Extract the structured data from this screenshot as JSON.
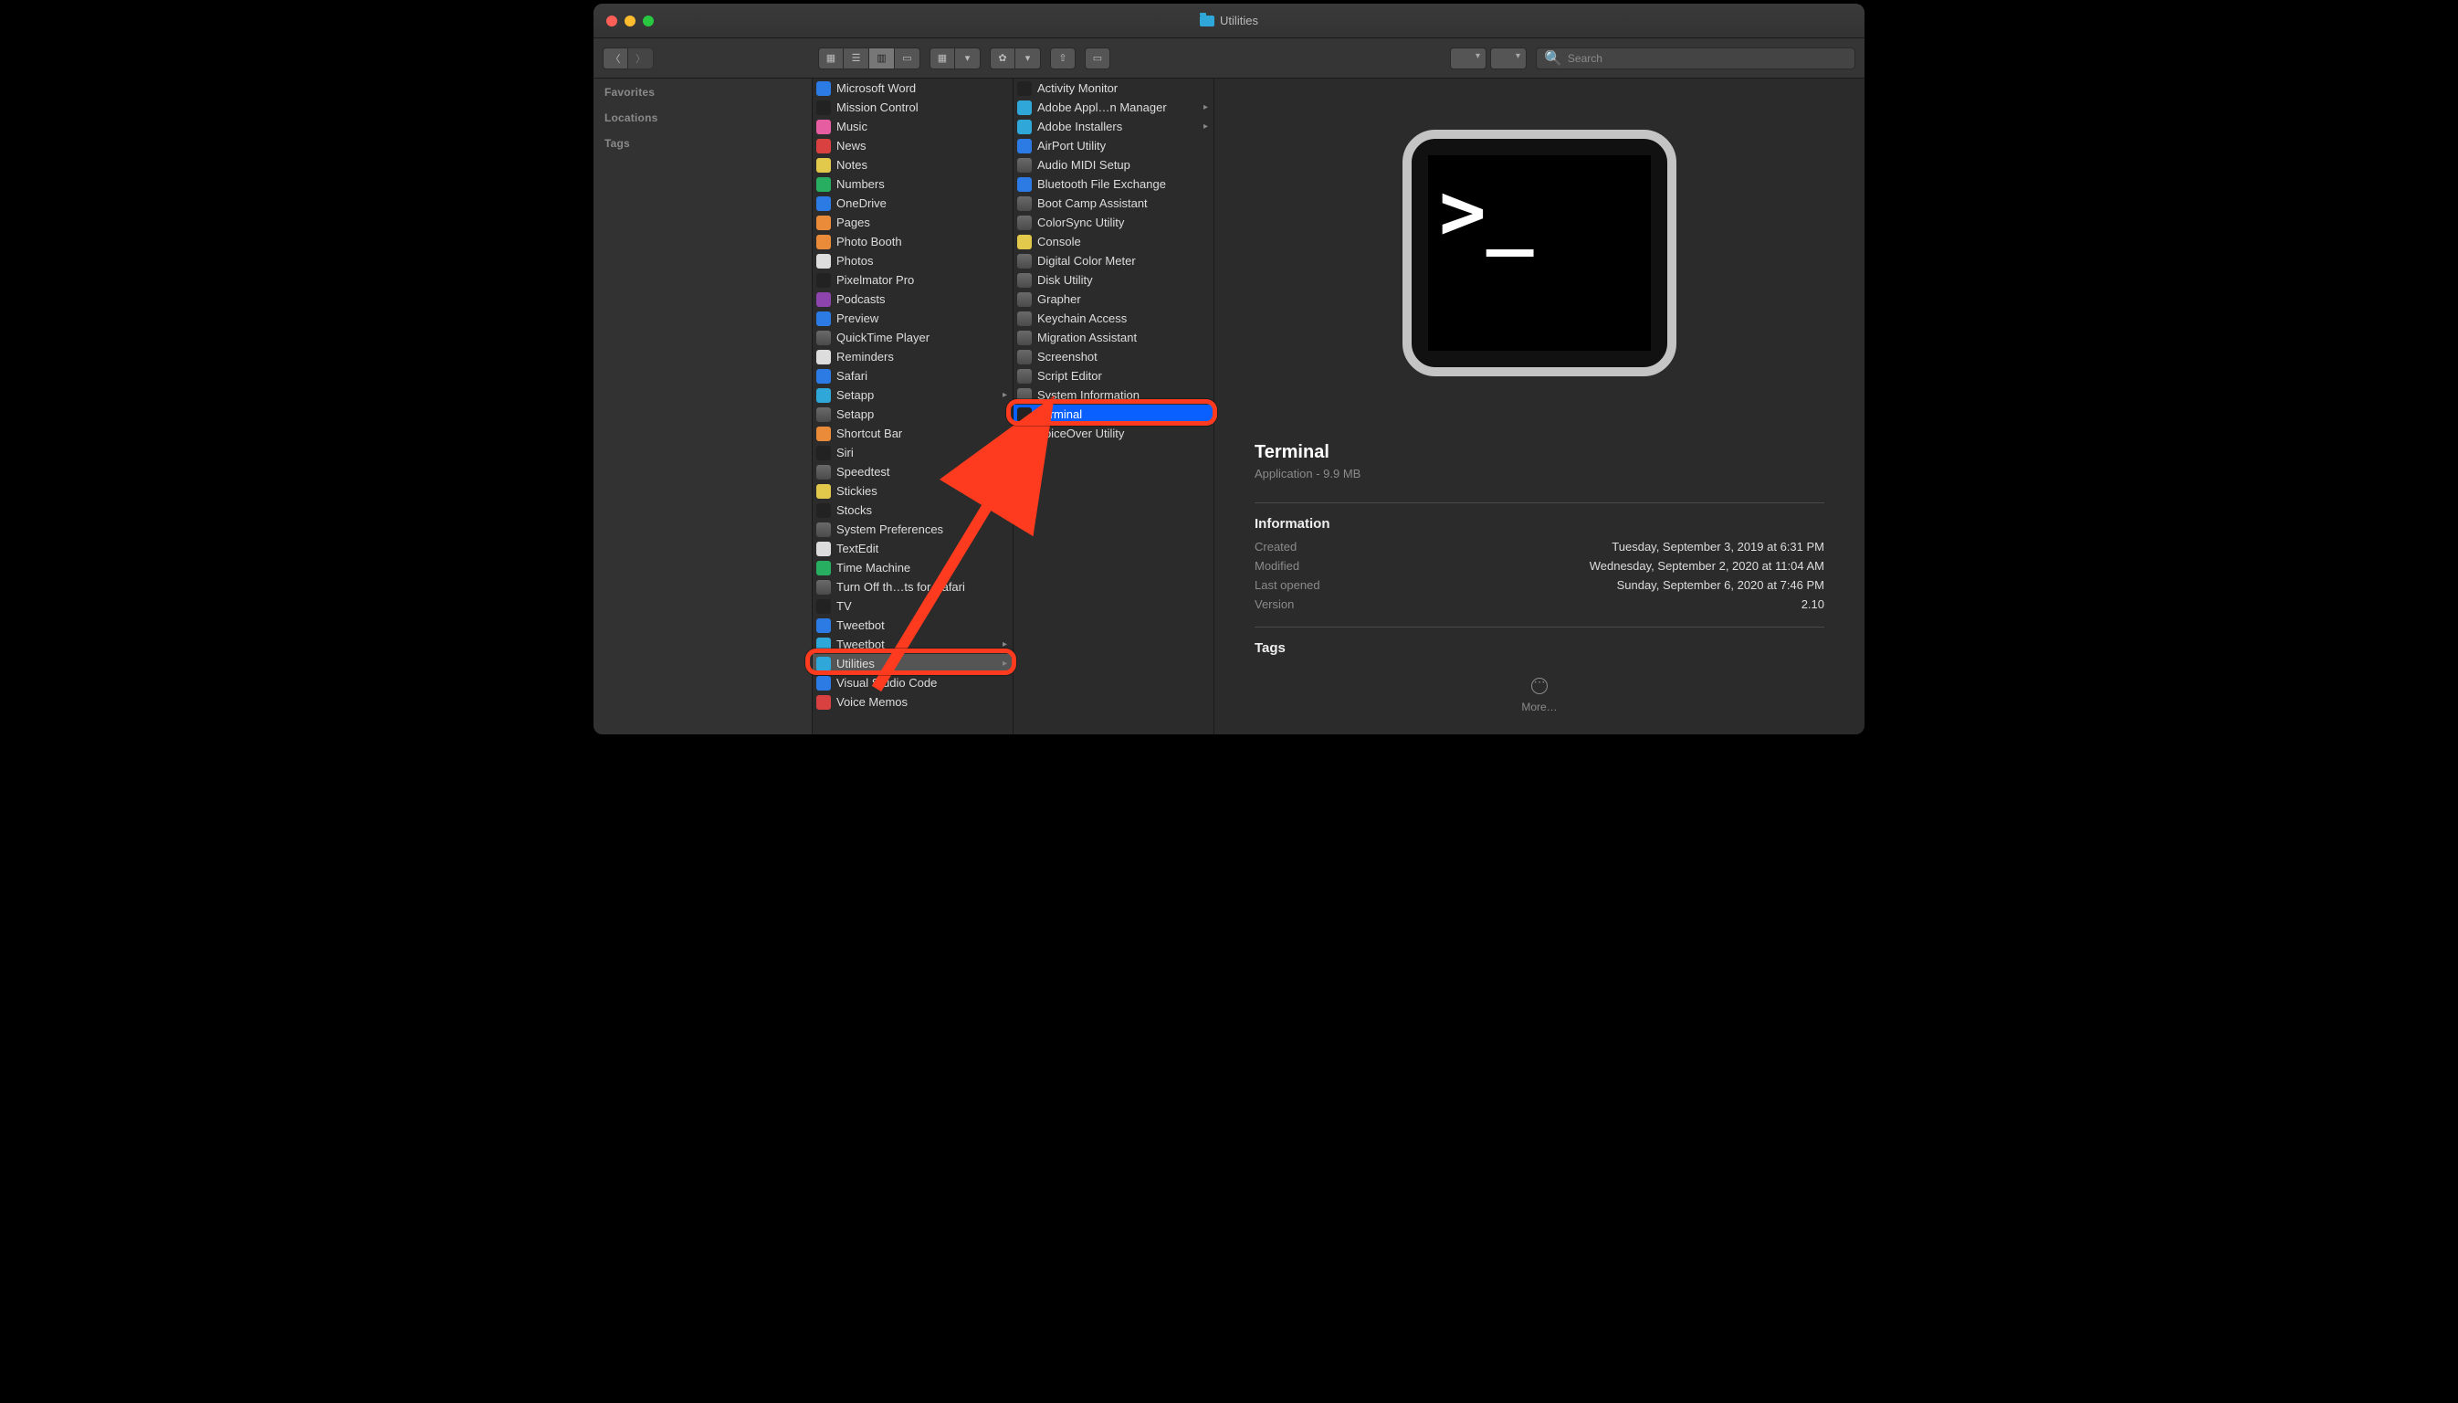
{
  "window": {
    "title": "Utilities"
  },
  "toolbar": {
    "search_placeholder": "Search"
  },
  "sidebar": {
    "sections": [
      "Favorites",
      "Locations",
      "Tags"
    ]
  },
  "column_apps": [
    {
      "label": "Microsoft Word",
      "icon": "blue"
    },
    {
      "label": "Mission Control",
      "icon": "black"
    },
    {
      "label": "Music",
      "icon": "pink"
    },
    {
      "label": "News",
      "icon": "red"
    },
    {
      "label": "Notes",
      "icon": "yellow"
    },
    {
      "label": "Numbers",
      "icon": "green"
    },
    {
      "label": "OneDrive",
      "icon": "blue"
    },
    {
      "label": "Pages",
      "icon": "orange"
    },
    {
      "label": "Photo Booth",
      "icon": "orange"
    },
    {
      "label": "Photos",
      "icon": "white"
    },
    {
      "label": "Pixelmator Pro",
      "icon": "black"
    },
    {
      "label": "Podcasts",
      "icon": "purple"
    },
    {
      "label": "Preview",
      "icon": "blue"
    },
    {
      "label": "QuickTime Player",
      "icon": "app"
    },
    {
      "label": "Reminders",
      "icon": "white"
    },
    {
      "label": "Safari",
      "icon": "blue"
    },
    {
      "label": "Setapp",
      "icon": "folder",
      "child": true
    },
    {
      "label": "Setapp",
      "icon": "app"
    },
    {
      "label": "Shortcut Bar",
      "icon": "orange"
    },
    {
      "label": "Siri",
      "icon": "black"
    },
    {
      "label": "Speedtest",
      "icon": "app"
    },
    {
      "label": "Stickies",
      "icon": "yellow"
    },
    {
      "label": "Stocks",
      "icon": "black"
    },
    {
      "label": "System Preferences",
      "icon": "app"
    },
    {
      "label": "TextEdit",
      "icon": "white"
    },
    {
      "label": "Time Machine",
      "icon": "green"
    },
    {
      "label": "Turn Off th…ts for Safari",
      "icon": "app"
    },
    {
      "label": "TV",
      "icon": "black"
    },
    {
      "label": "Tweetbot",
      "icon": "blue"
    },
    {
      "label": "Tweetbot",
      "icon": "folder",
      "child": true
    },
    {
      "label": "Utilities",
      "icon": "folder",
      "child": true,
      "selected": true,
      "ring": true
    },
    {
      "label": "Visual Studio Code",
      "icon": "blue"
    },
    {
      "label": "Voice Memos",
      "icon": "red"
    }
  ],
  "column_utilities": [
    {
      "label": "Activity Monitor",
      "icon": "black"
    },
    {
      "label": "Adobe Appl…n Manager",
      "icon": "folder",
      "child": true
    },
    {
      "label": "Adobe Installers",
      "icon": "folder",
      "child": true
    },
    {
      "label": "AirPort Utility",
      "icon": "blue"
    },
    {
      "label": "Audio MIDI Setup",
      "icon": "app"
    },
    {
      "label": "Bluetooth File Exchange",
      "icon": "blue"
    },
    {
      "label": "Boot Camp Assistant",
      "icon": "app"
    },
    {
      "label": "ColorSync Utility",
      "icon": "app"
    },
    {
      "label": "Console",
      "icon": "yellow"
    },
    {
      "label": "Digital Color Meter",
      "icon": "app"
    },
    {
      "label": "Disk Utility",
      "icon": "app"
    },
    {
      "label": "Grapher",
      "icon": "app"
    },
    {
      "label": "Keychain Access",
      "icon": "app"
    },
    {
      "label": "Migration Assistant",
      "icon": "app"
    },
    {
      "label": "Screenshot",
      "icon": "app"
    },
    {
      "label": "Script Editor",
      "icon": "app"
    },
    {
      "label": "System Information",
      "icon": "app"
    },
    {
      "label": "Terminal",
      "icon": "black",
      "highlight": true,
      "ring": true
    },
    {
      "label": "VoiceOver Utility",
      "icon": "app"
    }
  ],
  "preview": {
    "name": "Terminal",
    "subtitle": "Application - 9.9 MB",
    "info_header": "Information",
    "created_label": "Created",
    "created_value": "Tuesday, September 3, 2019 at 6:31 PM",
    "modified_label": "Modified",
    "modified_value": "Wednesday, September 2, 2020 at 11:04 AM",
    "lastopened_label": "Last opened",
    "lastopened_value": "Sunday, September 6, 2020 at 7:46 PM",
    "version_label": "Version",
    "version_value": "2.10",
    "tags_header": "Tags",
    "more_label": "More…"
  }
}
